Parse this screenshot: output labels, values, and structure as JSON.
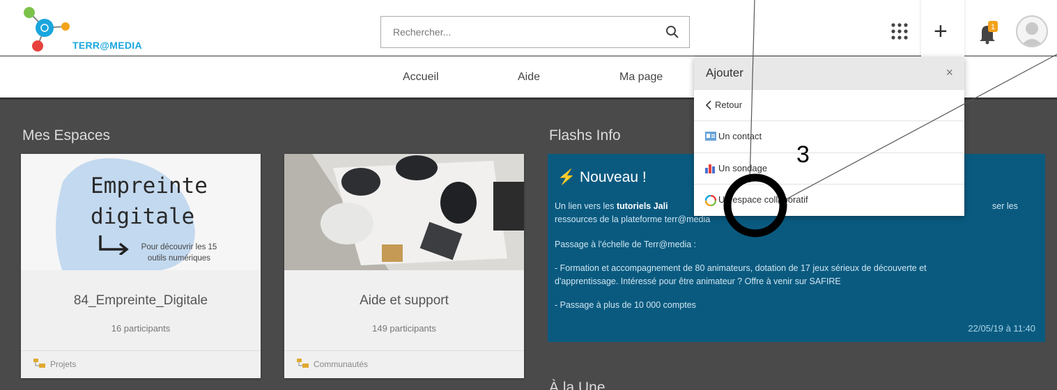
{
  "header": {
    "logo_text": "TERR@MEDIA",
    "search_placeholder": "Rechercher...",
    "notification_count": "1"
  },
  "nav": {
    "items": [
      "Accueil",
      "Aide",
      "Ma page"
    ]
  },
  "my_spaces": {
    "title": "Mes Espaces",
    "cards": [
      {
        "thumb_title_line1": "Empreinte",
        "thumb_title_line2": "digitale",
        "thumb_caption_line1": "Pour découvrir les 15",
        "thumb_caption_line2": "outils numériques",
        "name": "84_Empreinte_Digitale",
        "participants": "16 participants",
        "category": "Projets"
      },
      {
        "name": "Aide et support",
        "participants": "149 participants",
        "category": "Communautés"
      }
    ]
  },
  "flash_info": {
    "title": "Flashs Info",
    "card_title": "Nouveau !",
    "line1_start": "Un lien vers les",
    "line1_bold": "tutoriels Jali",
    "line1_end": "ser les",
    "line2": "ressources de la plateforme terr@media",
    "line3": "Passage à l'échelle de Terr@media :",
    "line4": "- Formation et accompagnement de 80 animateurs, dotation de 17 jeux sérieux de découverte et",
    "line5": "d'apprentissage. Intéressé pour être animateur ? Offre à venir sur SAFIRE",
    "line6": "- Passage  à plus de 10 000 comptes",
    "date": "22/05/19 à 11:40"
  },
  "next_section": {
    "title": "À la Une"
  },
  "add_menu": {
    "title": "Ajouter",
    "close": "×",
    "back": "Retour",
    "items": [
      "Un contact",
      "Un sondage",
      "Un espace collaboratif"
    ]
  },
  "annotation": {
    "step": "3"
  },
  "colors": {
    "accent": "#1aa6de",
    "flash_bg": "#0a5a80",
    "page_bg": "#4a4a4a"
  }
}
